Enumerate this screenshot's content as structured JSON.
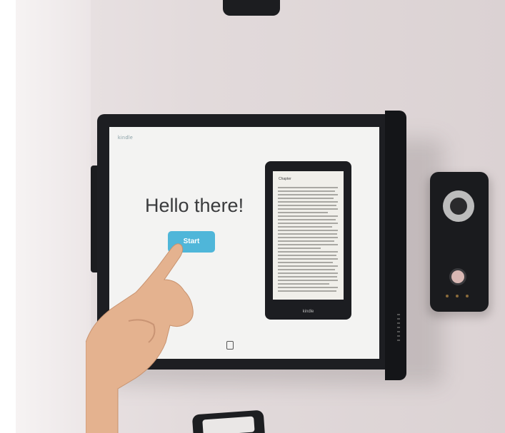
{
  "screen": {
    "brand_text": "kindle",
    "greeting": "Hello there!",
    "start_button": "Start"
  },
  "kindle_device": {
    "screen_heading": "Chapter",
    "logo": "kindle"
  },
  "colors": {
    "wall": "#dbd2d3",
    "monitor_frame": "#1d1e22",
    "screen_bg": "#f3f3f2",
    "start_button": "#4fb6d9",
    "skin": "#e6b592"
  }
}
